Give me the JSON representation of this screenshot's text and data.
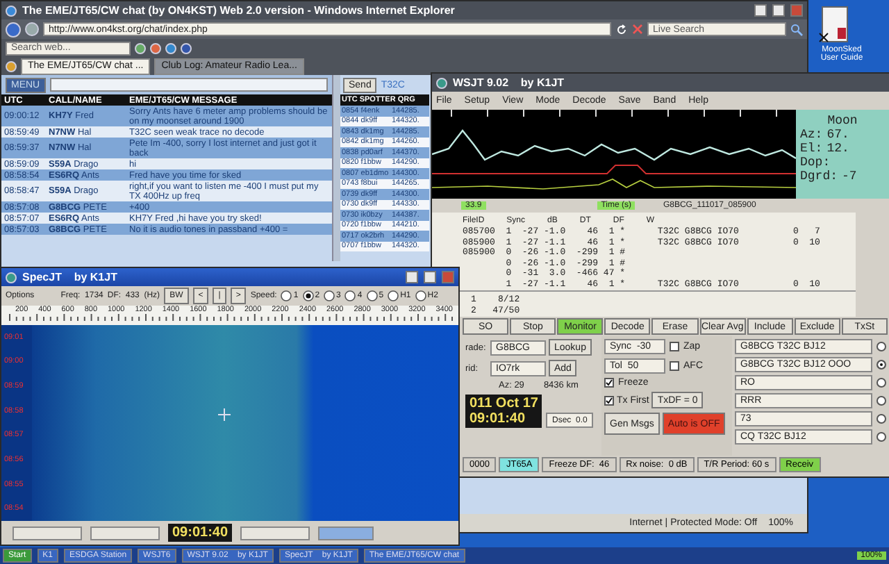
{
  "desktop_icon": {
    "label": "MoonSked User Guide"
  },
  "browser": {
    "title": "The EME/JT65/CW chat (by ON4KST) Web 2.0 version - Windows Internet Explorer",
    "url": "http://www.on4kst.org/chat/index.php",
    "live_search": {
      "placeholder": "Live Search"
    },
    "web_search": {
      "placeholder": "Search web..."
    },
    "tabs": [
      {
        "label": "The EME/JT65/CW chat ...",
        "selected": true
      },
      {
        "label": "Club Log: Amateur Radio Lea...",
        "selected": false
      }
    ],
    "chat": {
      "menu": "MENU",
      "send": "Send",
      "callsign": "T32C",
      "columns": [
        "UTC",
        "CALL/NAME",
        "EME/JT65/CW MESSAGE"
      ],
      "messages": [
        {
          "utc": "09:00:12",
          "call": "**KH7Y** Fred",
          "text": "Sorry Ants have 6 meter amp problems should be on my moonset around 1900"
        },
        {
          "utc": "08:59:49",
          "call": "**N7NW** Hal",
          "text": "T32C seen weak trace no decode"
        },
        {
          "utc": "08:59:37",
          "call": "**N7NW** Hal",
          "text": "Pete Im -400, sorry I lost internet and just got it back"
        },
        {
          "utc": "08:59:09",
          "call": "**S59A** Drago",
          "text": "hi"
        },
        {
          "utc": "08:58:54",
          "call": "**ES6RQ** Ants",
          "text": "Fred have you time for sked"
        },
        {
          "utc": "08:58:47",
          "call": "**S59A** Drago",
          "text": "right,if you want to listen me -400 I must put my TX 400Hz up freq"
        },
        {
          "utc": "08:57:08",
          "call": "**G8BCG** PETE",
          "text": "+400"
        },
        {
          "utc": "08:57:07",
          "call": "**ES6RQ** Ants",
          "text": "KH7Y Fred ,hi have you try sked!"
        },
        {
          "utc": "08:57:03",
          "call": "**G8BCG** PETE",
          "text": "No it is audio tones in passband +400 ="
        }
      ],
      "spotter_header": "UTC SPOTTER QRG",
      "spots": [
        {
          "spot": "0854 f4enk",
          "qrg": "144285."
        },
        {
          "spot": "0844 dk9ff",
          "qrg": "144320."
        },
        {
          "spot": "0843 dk1mg",
          "qrg": "144285."
        },
        {
          "spot": "0842 dk1mg",
          "qrg": "144260."
        },
        {
          "spot": "0838 pd0arf",
          "qrg": "144370."
        },
        {
          "spot": "0820 f1bbw",
          "qrg": "144290."
        },
        {
          "spot": "0807 eb1dmo",
          "qrg": "144300."
        },
        {
          "spot": "0743 f8bui",
          "qrg": "144265."
        },
        {
          "spot": "0739 dk9ff",
          "qrg": "144300."
        },
        {
          "spot": "0730 dk9ff",
          "qrg": "144330."
        },
        {
          "spot": "0730 ik0bzy",
          "qrg": "144387."
        },
        {
          "spot": "0720 f1bbw",
          "qrg": "144210."
        },
        {
          "spot": "0717 ok2brh",
          "qrg": "144290."
        },
        {
          "spot": "0707 f1bbw",
          "qrg": "144320."
        }
      ]
    },
    "status_zone": "Internet | Protected Mode: Off",
    "status_zoom": "100%"
  },
  "wsjt": {
    "title": "WSJT 9.02    by K1JT",
    "menu": [
      "File",
      "Setup",
      "View",
      "Mode",
      "Decode",
      "Save",
      "Band",
      "Help"
    ],
    "plot_labels": {
      "value": "33.9",
      "axis": "Time (s)",
      "file": "G8BCG_111017_085900"
    },
    "moon": {
      "title": "Moon",
      "rows": [
        {
          "label": "Az:",
          "value": "67."
        },
        {
          "label": "El:",
          "value": "12."
        },
        {
          "label": "Dop:",
          "value": ""
        },
        {
          "label": "Dgrd:",
          "value": "-7"
        }
      ]
    },
    "decode_columns": [
      "FileID",
      "Sync",
      "dB",
      "DT",
      "DF",
      "W"
    ],
    "decodes": [
      "085700  1  -27 -1.0    46  1 *      T32C G8BCG IO70          0   7",
      "085900  1  -27 -1.1    46  1 *      T32C G8BCG IO70          0  10",
      "085900  0  -26 -1.0  -299  1 #",
      "        0  -26 -1.0  -299  1 #",
      "        0  -31  3.0  -466 47 *",
      "        1  -27 -1.1    46  1 *      T32C G8BCG IO70          0  10"
    ],
    "averages": [
      "1    8/12",
      "2   47/50"
    ],
    "buttons": [
      {
        "label": "SO",
        "selected": false
      },
      {
        "label": "Stop",
        "selected": false
      },
      {
        "label": "Monitor",
        "selected": true
      },
      {
        "label": "Decode",
        "selected": false
      },
      {
        "label": "Erase",
        "selected": false
      },
      {
        "label": "Clear Avg",
        "selected": false
      },
      {
        "label": "Include",
        "selected": false
      },
      {
        "label": "Exclude",
        "selected": false
      },
      {
        "label": "TxSt",
        "selected": false
      }
    ],
    "to_radio": {
      "label": "rade:",
      "value": "G8BCG",
      "button": "Lookup"
    },
    "grid": {
      "label": "rid:",
      "value": "IO7rk",
      "button": "Add"
    },
    "azimuth": "Az: 29",
    "distance": "8436 km",
    "clock": [
      "011 Oct 17",
      "09:01:40"
    ],
    "dsec": "Dsec  0.0",
    "sync": {
      "label": "Sync",
      "value": "-30"
    },
    "tol": {
      "label": "Tol",
      "value": "50"
    },
    "checks": [
      {
        "label": "Zap",
        "checked": false
      },
      {
        "label": "AFC",
        "checked": false
      },
      {
        "label": "Freeze",
        "checked": true
      },
      {
        "label": "Tx First",
        "checked": true
      }
    ],
    "txdf": "TxDF = 0",
    "gen_msgs": "Gen Msgs",
    "auto": {
      "label": "Auto is OFF",
      "on": false
    },
    "messages": [
      {
        "text": "G8BCG T32C BJ12",
        "selected": false
      },
      {
        "text": "G8BCG T32C BJ12 OOO",
        "selected": true
      },
      {
        "text": "RO",
        "selected": false
      },
      {
        "text": "RRR",
        "selected": false
      },
      {
        "text": "73",
        "selected": false
      },
      {
        "text": "CQ T32C BJ12",
        "selected": false
      }
    ],
    "status": [
      {
        "text": "0000",
        "kind": "plain"
      },
      {
        "text": "JT65A",
        "kind": "mode"
      },
      {
        "text": "Freeze DF:  46",
        "kind": "plain"
      },
      {
        "text": "Rx noise:  0 dB",
        "kind": "plain"
      },
      {
        "text": "T/R Period: 60 s",
        "kind": "plain"
      },
      {
        "text": "Receiv",
        "kind": "receiving"
      }
    ]
  },
  "specjt": {
    "title": "SpecJT    by K1JT",
    "options": "Options",
    "freq": "Freq:  1734",
    "df": "DF:  433  (Hz)",
    "bw": "BW",
    "nav": [
      "<",
      "|",
      ">"
    ],
    "speed_label": "Speed:",
    "speeds": [
      {
        "label": "1",
        "selected": false
      },
      {
        "label": "2",
        "selected": true
      },
      {
        "label": "3",
        "selected": false
      },
      {
        "label": "4",
        "selected": false
      },
      {
        "label": "5",
        "selected": false
      },
      {
        "label": "H1",
        "selected": false
      },
      {
        "label": "H2",
        "selected": false
      }
    ],
    "scale": [
      "200",
      "400",
      "600",
      "800",
      "1000",
      "1200",
      "1400",
      "1600",
      "1800",
      "2000",
      "2200",
      "2400",
      "2600",
      "2800",
      "3000",
      "3200",
      "3400"
    ],
    "times": [
      "09:01",
      "09:00",
      "08:59",
      "08:58",
      "08:57",
      "08:56",
      "08:55",
      "08:54"
    ],
    "clock": "09:01:40"
  },
  "taskbar": {
    "start": "Start",
    "items": [
      "K1",
      "ESDGA Station",
      "WSJT6",
      "WSJT 9.02    by K1JT",
      "SpecJT    by K1JT",
      "The EME/JT65/CW chat"
    ],
    "zoom": "100%"
  }
}
